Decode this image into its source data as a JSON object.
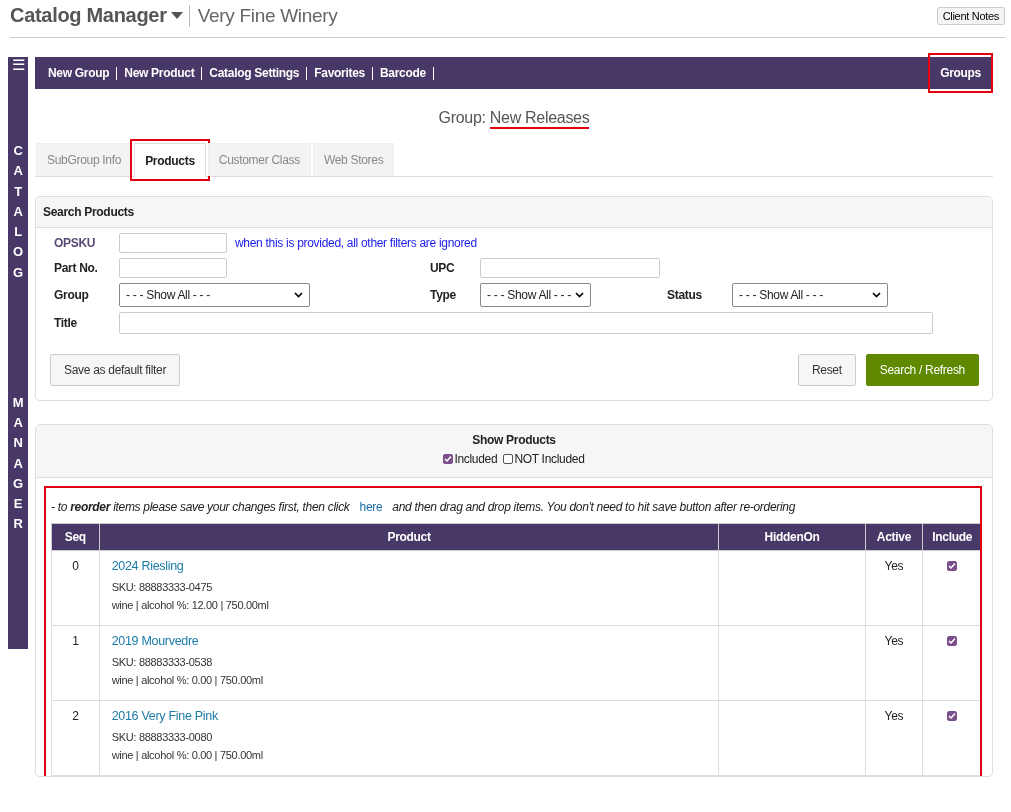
{
  "header": {
    "app_title": "Catalog Manager",
    "company": "Very Fine Winery",
    "client_notes": "Client Notes"
  },
  "sidebar": {
    "menu_icon": "☰",
    "words": [
      "CATALOG",
      "MANAGER"
    ]
  },
  "nav": {
    "items": [
      "New Group",
      "New Product",
      "Catalog Settings",
      "Favorites",
      "Barcode"
    ],
    "groups": {
      "label": "Groups",
      "highlighted": true
    }
  },
  "group": {
    "label": "Group:",
    "name": "New Releases",
    "underlined": true
  },
  "tabs": [
    {
      "label": "SubGroup Info",
      "selected": false,
      "highlighted": false
    },
    {
      "label": "Products",
      "selected": true,
      "highlighted": true
    },
    {
      "label": "Customer Class",
      "selected": false,
      "highlighted": false
    },
    {
      "label": "Web Stores",
      "selected": false,
      "highlighted": false
    }
  ],
  "search": {
    "title": "Search Products",
    "opsku_label": "OPSKU",
    "opsku_hint": "when this is provided, all other filters are ignored",
    "part_label": "Part No.",
    "upc_label": "UPC",
    "group_label": "Group",
    "group_value": "- - - Show All - - -",
    "type_label": "Type",
    "type_value": "- - - Show All - - -",
    "status_label": "Status",
    "status_value": "- - - Show All - - -",
    "title_label": "Title",
    "save_default": "Save as default filter",
    "reset": "Reset",
    "refresh": "Search / Refresh"
  },
  "show": {
    "title": "Show Products",
    "filters": [
      {
        "label": "Included",
        "checked": true
      },
      {
        "label": "NOT Included",
        "checked": false
      }
    ]
  },
  "list": {
    "highlighted": true,
    "note_before": "- to **reorder** items please save your changes first, then click",
    "link": "here",
    "note_after": "and then drag and drop items. You don't need to hit save button after re-ordering",
    "columns": [
      "Seq",
      "Product",
      "HiddenOn",
      "Active",
      "Include"
    ],
    "rows": [
      {
        "seq": "0",
        "title": "2024 Riesling",
        "sku": "SKU: 88883333-0475",
        "details": "wine | alcohol %: 12.00 | 750.00ml",
        "active": "Yes",
        "included": true
      },
      {
        "seq": "1",
        "title": "2019 Mourvedre",
        "sku": "SKU: 88883333-0538",
        "details": "wine | alcohol %: 0.00 | 750.00ml",
        "active": "Yes",
        "included": true
      },
      {
        "seq": "2",
        "title": "2016 Very Fine Pink",
        "sku": "SKU: 88883333-0080",
        "details": "wine | alcohol %: 0.00 | 750.00ml",
        "active": "Yes",
        "included": true
      }
    ]
  }
}
